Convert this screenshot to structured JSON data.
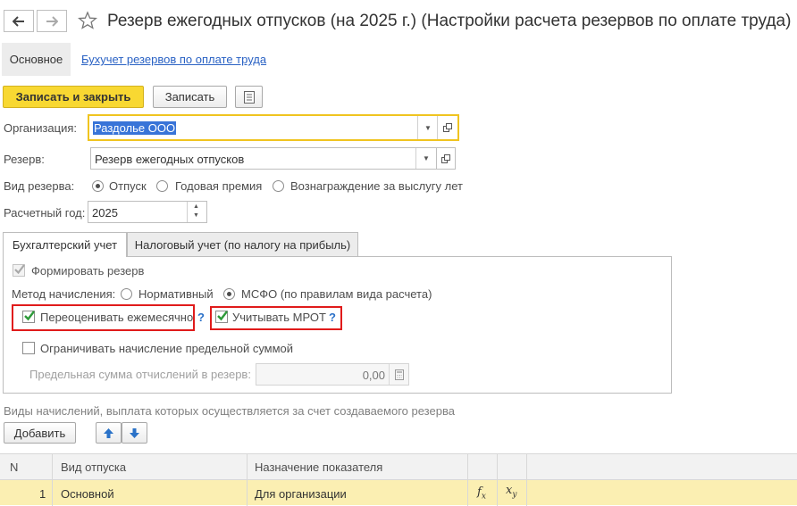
{
  "window": {
    "title": "Резерв ежегодных отпусков (на 2025 г.) (Настройки расчета резервов по оплате труда)"
  },
  "nav_tabs": {
    "main": "Основное",
    "link": "Бухучет резервов по оплате труда"
  },
  "toolbar": {
    "save_close": "Записать и закрыть",
    "save": "Записать"
  },
  "form": {
    "org_label": "Организация:",
    "org_value": "Раздолье ООО",
    "reserve_label": "Резерв:",
    "reserve_value": "Резерв ежегодных отпусков",
    "kind_label": "Вид резерва:",
    "kind_options": [
      "Отпуск",
      "Годовая премия",
      "Вознаграждение за выслугу лет"
    ],
    "kind_selected": "Отпуск",
    "year_label": "Расчетный год:",
    "year_value": "2025"
  },
  "tabs": {
    "accounting": "Бухгалтерский учет",
    "tax": "Налоговый учет (по налогу на прибыль)"
  },
  "accounting": {
    "form_reserve": "Формировать резерв",
    "form_reserve_checked": true,
    "method_label": "Метод начисления:",
    "method_options": [
      "Нормативный",
      "МСФО (по правилам вида расчета)"
    ],
    "method_selected": "МСФО (по правилам вида расчета)",
    "revalue": "Переоценивать ежемесячно",
    "revalue_checked": true,
    "mrot": "Учитывать МРОТ",
    "mrot_checked": true,
    "limit": "Ограничивать начисление предельной суммой",
    "limit_checked": false,
    "limit_sum_label": "Предельная сумма отчислений в резерв:",
    "limit_sum_value": "0,00",
    "help_mark": "?"
  },
  "accruals": {
    "caption": "Виды начислений, выплата которых осуществляется за счет создаваемого резерва",
    "add_button": "Добавить"
  },
  "table": {
    "columns": [
      "N",
      "Вид отпуска",
      "Назначение показателя"
    ],
    "rows": [
      {
        "n": "1",
        "kind": "Основной",
        "purpose": "Для организации"
      }
    ]
  },
  "colors": {
    "primary_button": "#f8d832",
    "focus_border": "#f0c420",
    "highlight_box": "#e01b1b",
    "link": "#2a62c4",
    "selected_row": "#fbefb2",
    "check_green": "#2e9a3a"
  }
}
